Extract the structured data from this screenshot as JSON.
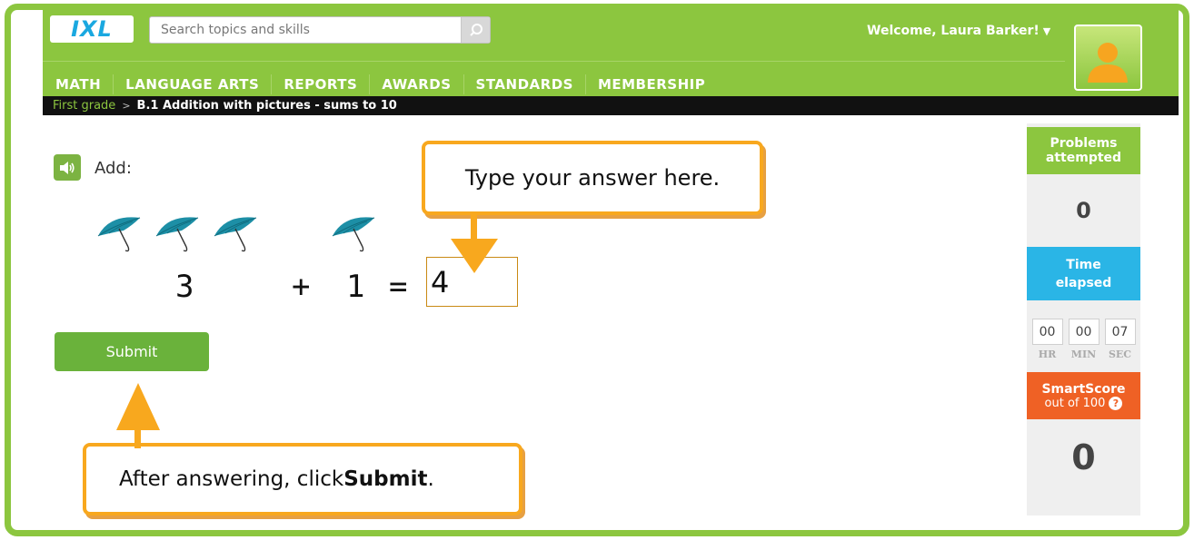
{
  "header": {
    "logo": "IXL",
    "search_placeholder": "Search topics and skills",
    "welcome": "Welcome, Laura Barker!",
    "nav": [
      "MATH",
      "LANGUAGE ARTS",
      "REPORTS",
      "AWARDS",
      "STANDARDS",
      "MEMBERSHIP"
    ]
  },
  "breadcrumb": {
    "grade": "First grade",
    "separator": ">",
    "skill": "B.1 Addition with pictures - sums to 10"
  },
  "question": {
    "prompt": "Add:",
    "left_count": 3,
    "right_count": 1,
    "addend1": "3",
    "plus": "+",
    "addend2": "1",
    "equals": "=",
    "answer": "4"
  },
  "submit_label": "Submit",
  "callouts": {
    "top": "Type your answer here.",
    "bottom_prefix": "After answering, click ",
    "bottom_bold": "Submit",
    "bottom_suffix": "."
  },
  "sidebar": {
    "problems_title": "Problems attempted",
    "problems_value": "0",
    "time_title": "Time elapsed",
    "hr": "00",
    "min": "00",
    "sec": "07",
    "hr_label": "HR",
    "min_label": "MIN",
    "sec_label": "SEC",
    "smartscore_title": "SmartScore",
    "smartscore_sub": "out of 100",
    "smartscore_help": "?",
    "smartscore_value": "0"
  },
  "colors": {
    "brand_green": "#8cc63f",
    "callout_orange": "#f8a81e",
    "timer_blue": "#2ab5e6",
    "score_orange": "#ef6125"
  }
}
